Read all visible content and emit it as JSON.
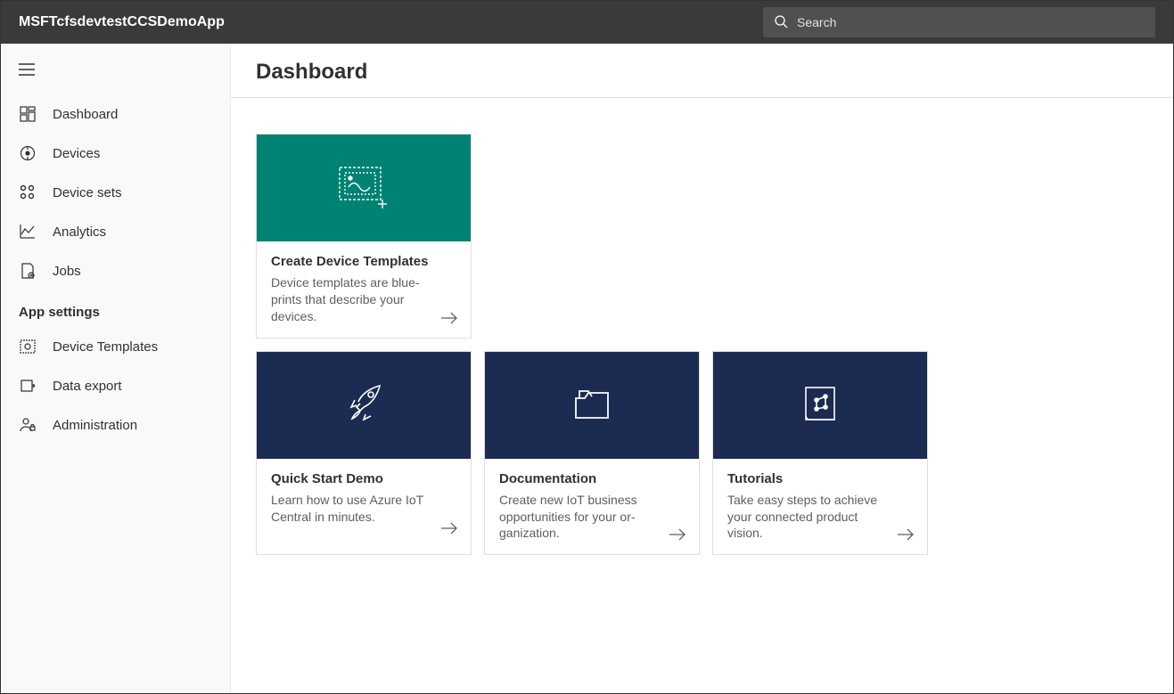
{
  "header": {
    "app_title": "MSFTcfsdevtestCCSDemoApp",
    "search_placeholder": "Search"
  },
  "sidebar": {
    "items": [
      {
        "icon": "dashboard-icon",
        "label": "Dashboard"
      },
      {
        "icon": "devices-icon",
        "label": "Devices"
      },
      {
        "icon": "device-sets-icon",
        "label": "Device sets"
      },
      {
        "icon": "analytics-icon",
        "label": "Analytics"
      },
      {
        "icon": "jobs-icon",
        "label": "Jobs"
      }
    ],
    "section_heading": "App settings",
    "settings_items": [
      {
        "icon": "device-templates-icon",
        "label": "Device Templates"
      },
      {
        "icon": "data-export-icon",
        "label": "Data export"
      },
      {
        "icon": "administration-icon",
        "label": "Administration"
      }
    ]
  },
  "page": {
    "title": "Dashboard"
  },
  "cards": {
    "row1": [
      {
        "hero_color": "teal",
        "icon": "template-add-icon",
        "title": "Create Device Templates",
        "desc": "Device templates are blue-prints that describe your devices."
      }
    ],
    "row2": [
      {
        "hero_color": "navy",
        "icon": "rocket-icon",
        "title": "Quick Start Demo",
        "desc": "Learn how to use Azure IoT Central in minutes."
      },
      {
        "hero_color": "navy",
        "icon": "folder-icon",
        "title": "Documentation",
        "desc": "Create new IoT business opportunities for your or-ganization."
      },
      {
        "hero_color": "navy",
        "icon": "tutorial-icon",
        "title": "Tutorials",
        "desc": "Take easy steps to achieve your connected product vision."
      }
    ]
  }
}
